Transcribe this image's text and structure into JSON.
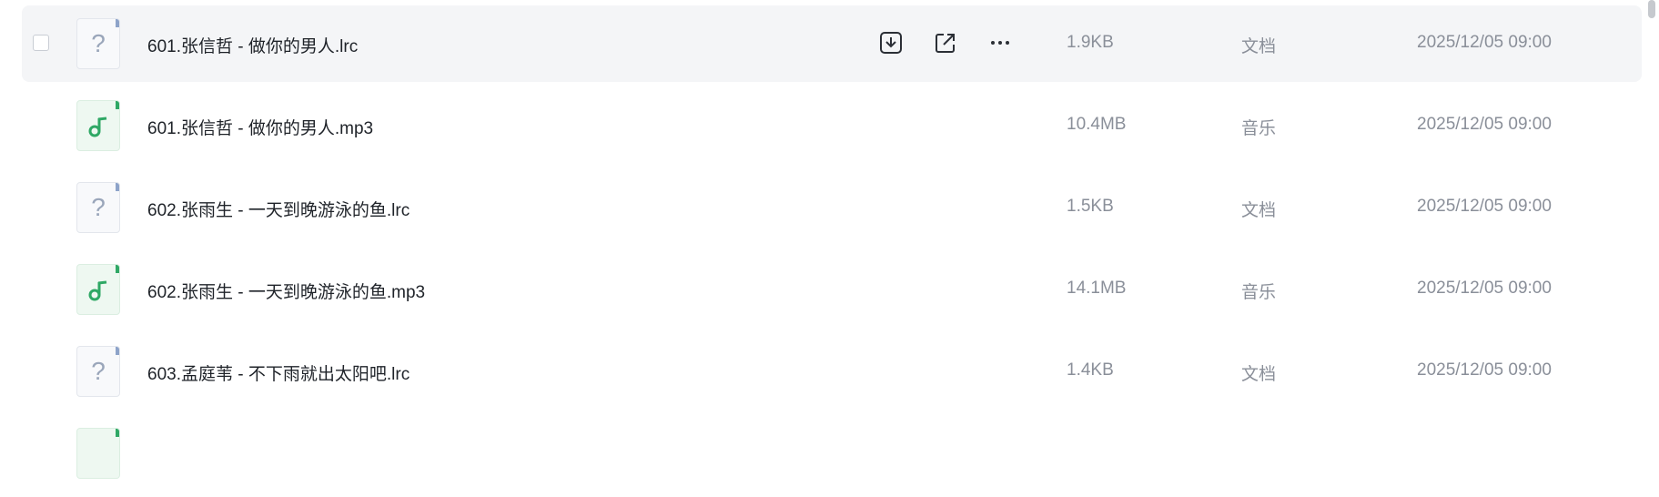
{
  "files": [
    {
      "name": "601.张信哲 - 做你的男人.lrc",
      "size": "1.9KB",
      "type": "文档",
      "date": "2025/12/05 09:00",
      "icon": "unknown-file-icon"
    },
    {
      "name": "601.张信哲 - 做你的男人.mp3",
      "size": "10.4MB",
      "type": "音乐",
      "date": "2025/12/05 09:00",
      "icon": "music-file-icon"
    },
    {
      "name": "602.张雨生 - 一天到晚游泳的鱼.lrc",
      "size": "1.5KB",
      "type": "文档",
      "date": "2025/12/05 09:00",
      "icon": "unknown-file-icon"
    },
    {
      "name": "602.张雨生 - 一天到晚游泳的鱼.mp3",
      "size": "14.1MB",
      "type": "音乐",
      "date": "2025/12/05 09:00",
      "icon": "music-file-icon"
    },
    {
      "name": "603.孟庭苇 - 不下雨就出太阳吧.lrc",
      "size": "1.4KB",
      "type": "文档",
      "date": "2025/12/05 09:00",
      "icon": "unknown-file-icon"
    }
  ],
  "row_actions": [
    "download-icon",
    "share-icon",
    "more-icon"
  ],
  "colors": {
    "hover_row": "#f4f5f7",
    "music_accent": "#2fa865",
    "meta_text": "#8a8f99"
  }
}
